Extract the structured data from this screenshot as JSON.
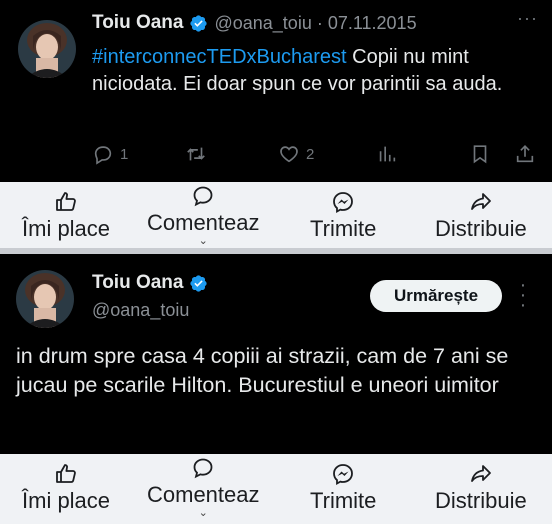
{
  "tweet1": {
    "author_name": "Toiu Oana",
    "handle_date": "@oana_toiu · 07.11.2015",
    "hashtag": "#interconnecTEDxBucharest",
    "text": " Copii nu mint niciodata. Ei doar spun ce vor parintii sa auda.",
    "more": "···",
    "replies": "1",
    "likes": "2"
  },
  "fb_bar1": {
    "like": "Îmi place",
    "comment": "Comenteaz",
    "send": "Trimite",
    "share": "Distribuie"
  },
  "tweet2": {
    "author_name": "Toiu Oana",
    "handle": "@oana_toiu",
    "follow_label": "Urmărește",
    "more": "⋮",
    "text": "in drum spre casa 4 copiii ai strazii, cam de 7 ani se jucau pe scarile Hilton. Bucurestiul e uneori uimitor"
  },
  "fb_bar2": {
    "like": "Îmi place",
    "comment": "Comenteaz",
    "send": "Trimite",
    "share": "Distribuie"
  },
  "colors": {
    "tweet_background": "#000000",
    "tweet_text": "#e7e9ea",
    "muted": "#71767b",
    "link_blue": "#1d9bf0",
    "verified_blue": "#1d9bf0",
    "fb_bar_background": "#f0f2f5"
  },
  "icons": {
    "reply": "speech-bubble-icon",
    "retweet": "retweet-arrows-icon",
    "like": "heart-icon",
    "views": "bar-chart-icon",
    "bookmark": "bookmark-icon",
    "share": "share-upload-icon",
    "verified": "verified-badge-icon",
    "fb_like": "thumbs-up-icon",
    "fb_comment": "comment-bubble-icon",
    "fb_send": "messenger-icon",
    "fb_share": "share-arrow-icon"
  }
}
